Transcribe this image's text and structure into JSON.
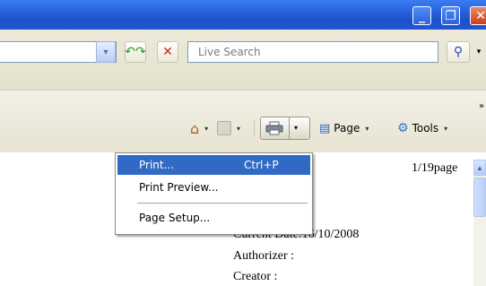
{
  "window": {
    "minimize_glyph": "_",
    "maximize_glyph": "❐",
    "close_glyph": "✕"
  },
  "address_bar": {
    "refresh_icon": "↶↷",
    "stop_icon": "✕",
    "dropdown_icon": "▾"
  },
  "search": {
    "placeholder": "Live Search",
    "go_icon": "⚲",
    "dropdown_icon": "▾"
  },
  "command_bar": {
    "home_icon": "⌂",
    "page_label": "Page",
    "tools_label": "Tools",
    "chevron": "▾",
    "overflow": "»"
  },
  "print_menu": {
    "items": [
      {
        "label": "Print...",
        "shortcut": "Ctrl+P",
        "selected": true
      },
      {
        "label": "Print Preview...",
        "shortcut": ""
      },
      {
        "label": "Page Setup...",
        "shortcut": ""
      }
    ]
  },
  "document": {
    "page_count": "1/19page",
    "lines": [
      "Current Date:16/10/2008",
      "Authorizer  :",
      "Creator      :"
    ]
  },
  "colors": {
    "titlebar": "#2a63e0",
    "menu_highlight": "#316ac5"
  }
}
